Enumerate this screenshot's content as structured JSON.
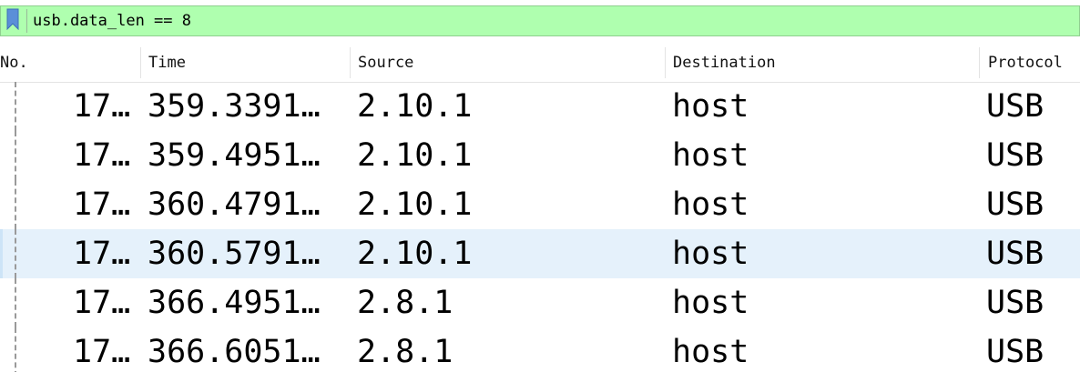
{
  "filter": {
    "value": "usb.data_len == 8",
    "bookmark_icon": "bookmark-icon",
    "background": "#afffaf"
  },
  "columns": {
    "no": "No.",
    "time": "Time",
    "source": "Source",
    "destination": "Destination",
    "protocol": "Protocol"
  },
  "rows": [
    {
      "no": "17…",
      "time": "359.3391…",
      "source": "2.10.1",
      "destination": "host",
      "protocol": "USB"
    },
    {
      "no": "17…",
      "time": "359.4951…",
      "source": "2.10.1",
      "destination": "host",
      "protocol": "USB"
    },
    {
      "no": "17…",
      "time": "360.4791…",
      "source": "2.10.1",
      "destination": "host",
      "protocol": "USB"
    },
    {
      "no": "17…",
      "time": "360.5791…",
      "source": "2.10.1",
      "destination": "host",
      "protocol": "USB"
    },
    {
      "no": "17…",
      "time": "366.4951…",
      "source": "2.8.1",
      "destination": "host",
      "protocol": "USB"
    },
    {
      "no": "17…",
      "time": "366.6051…",
      "source": "2.8.1",
      "destination": "host",
      "protocol": "USB"
    }
  ],
  "selected_row_background": "#e5f1fb"
}
